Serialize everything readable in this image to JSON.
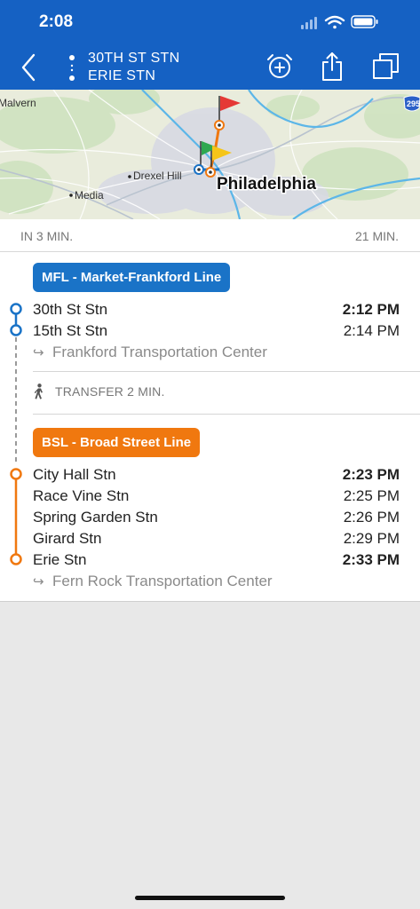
{
  "status_bar": {
    "time": "2:08"
  },
  "header": {
    "from_stop": "30TH ST STN",
    "to_stop": "ERIE STN"
  },
  "map": {
    "labels": {
      "malvern": "Malvern",
      "drexel_hill": "Drexel Hill",
      "media": "Media",
      "philadelphia": "Philadelphia",
      "highway": "295"
    }
  },
  "duration": {
    "departs": "IN 3 MIN.",
    "total": "21 MIN."
  },
  "legs": [
    {
      "line": "MFL - Market-Frankford Line",
      "color": "#1a73c7",
      "stops": [
        {
          "name": "30th St Stn",
          "time": "2:12 PM"
        },
        {
          "name": "15th St Stn",
          "time": "2:14 PM"
        }
      ],
      "direction": "Frankford Transportation Center"
    },
    {
      "line": "BSL - Broad Street Line",
      "color": "#f0780f",
      "stops": [
        {
          "name": "City Hall Stn",
          "time": "2:23 PM"
        },
        {
          "name": "Race Vine Stn",
          "time": "2:25 PM"
        },
        {
          "name": "Spring Garden Stn",
          "time": "2:26 PM"
        },
        {
          "name": "Girard Stn",
          "time": "2:29 PM"
        },
        {
          "name": "Erie Stn",
          "time": "2:33 PM"
        }
      ],
      "direction": "Fern Rock Transportation Center"
    }
  ],
  "transfer": {
    "label": "TRANSFER 2 MIN."
  },
  "icons": {
    "back": "chevron-left-icon",
    "alarm": "alarm-add-icon",
    "share": "share-icon",
    "copy": "copy-icon",
    "walk": "walking-person-icon"
  },
  "colors": {
    "header": "#1561c3",
    "mfl": "#1a73c7",
    "bsl": "#f0780f"
  }
}
